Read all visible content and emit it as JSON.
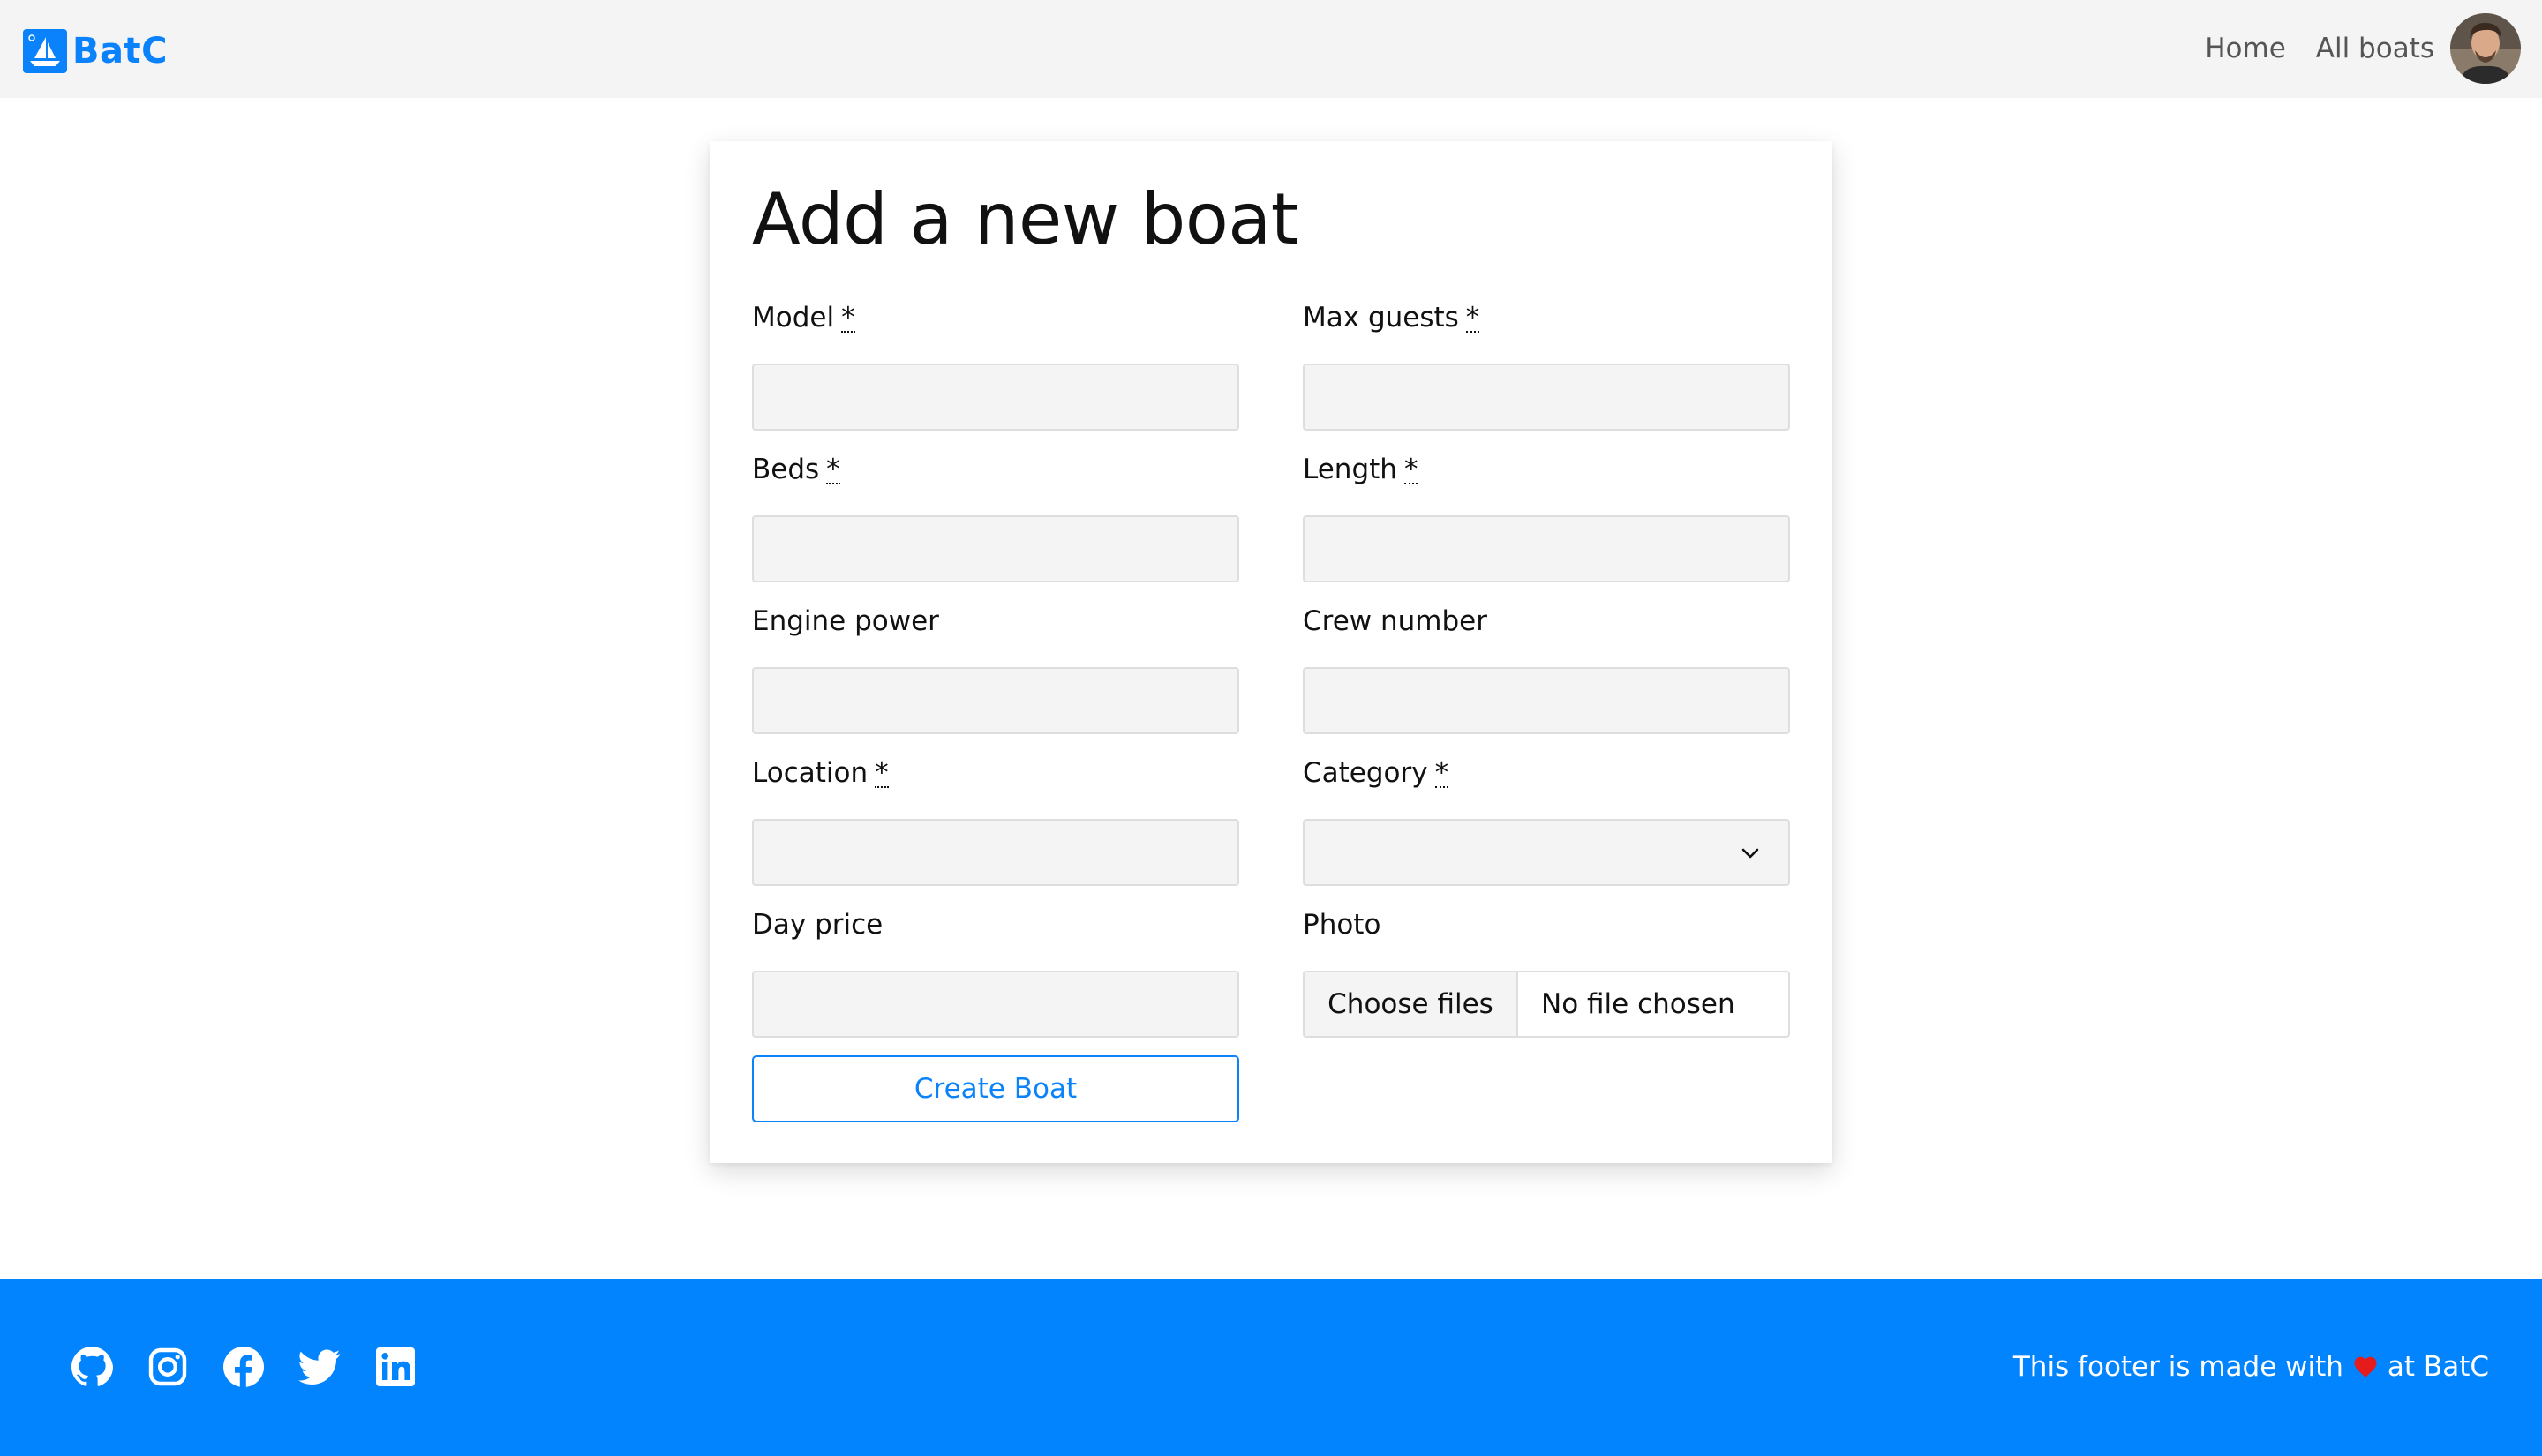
{
  "navbar": {
    "brand": "BatC",
    "links": [
      "Home",
      "All boats"
    ]
  },
  "form": {
    "title": "Add a new boat",
    "required_marker": "*",
    "fields": {
      "model": "Model",
      "max_guests": "Max guests",
      "beds": "Beds",
      "length": "Length",
      "engine_power": "Engine power",
      "crew_number": "Crew number",
      "location": "Location",
      "category": "Category",
      "day_price": "Day price",
      "photo": "Photo"
    },
    "file_button": "Choose files",
    "file_status": "No file chosen",
    "submit": "Create Boat"
  },
  "footer": {
    "text_before": "This footer is made with",
    "text_after": "at BatC",
    "icons": [
      "github-icon",
      "instagram-icon",
      "facebook-icon",
      "twitter-icon",
      "linkedin-icon"
    ]
  },
  "colors": {
    "accent": "#0a82fb",
    "footer_bg": "#0284fe",
    "heart": "#e61b1b",
    "navbar_bg": "#f4f4f4",
    "input_bg": "#f4f4f4"
  }
}
